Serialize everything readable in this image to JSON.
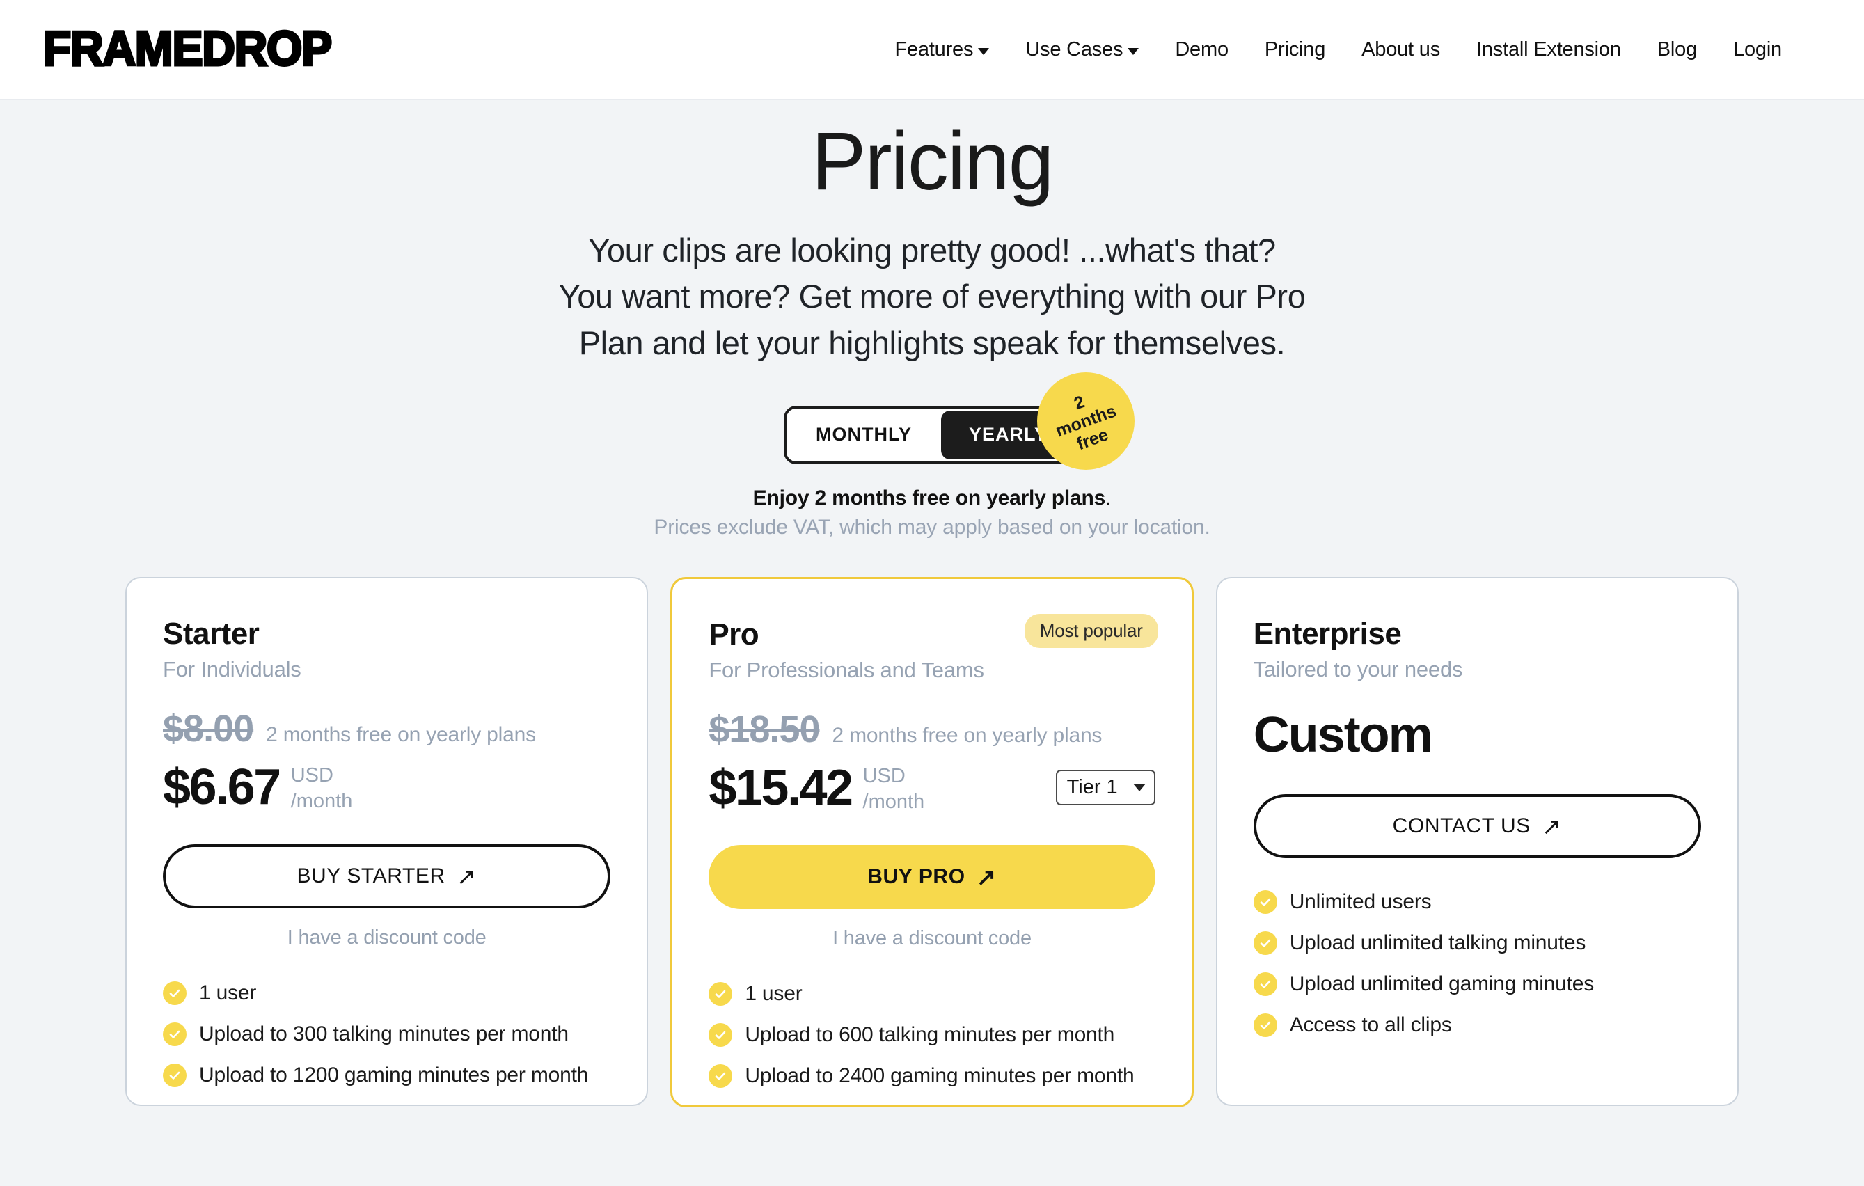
{
  "header": {
    "logo": "FRAMEDROP",
    "nav": [
      {
        "label": "Features",
        "has_caret": true
      },
      {
        "label": "Use Cases",
        "has_caret": true
      },
      {
        "label": "Demo",
        "has_caret": false
      },
      {
        "label": "Pricing",
        "has_caret": false
      },
      {
        "label": "About us",
        "has_caret": false
      },
      {
        "label": "Install Extension",
        "has_caret": false
      },
      {
        "label": "Blog",
        "has_caret": false
      },
      {
        "label": "Login",
        "has_caret": false
      }
    ]
  },
  "hero": {
    "title": "Pricing",
    "subtitle_line1": "Your clips are looking pretty good! ...what's that?",
    "subtitle_line2": "You want more? Get more of everything with our Pro",
    "subtitle_line3": "Plan and let your highlights speak for themselves."
  },
  "billing_toggle": {
    "monthly_label": "MONTHLY",
    "yearly_label": "YEARLY",
    "selected": "YEARLY",
    "badge_line1": "2",
    "badge_line2": "months",
    "badge_line3": "free",
    "note_bold": "Enjoy 2 months free on yearly plans",
    "note_bold_period": ".",
    "note_muted": "Prices exclude VAT, which may apply based on your location."
  },
  "colors": {
    "accent_yellow": "#F7D94C",
    "badge_yellow": "#F8E59B",
    "page_background": "#F2F4F6",
    "muted_text": "#96A2B2",
    "featured_border": "#F0C93B"
  },
  "plans": [
    {
      "name": "Starter",
      "audience": "For Individuals",
      "old_price": "$8.00",
      "free_note": "2 months free on yearly plans",
      "price": "$6.67",
      "currency": "USD",
      "period": "/month",
      "cta_label": "BUY STARTER",
      "discount_link": "I have a discount code",
      "features": [
        "1 user",
        "Upload to 300 talking minutes per month",
        "Upload to 1200 gaming minutes per month"
      ]
    },
    {
      "name": "Pro",
      "audience": "For Professionals and Teams",
      "popular_badge": "Most popular",
      "old_price": "$18.50",
      "free_note": "2 months free on yearly plans",
      "price": "$15.42",
      "currency": "USD",
      "period": "/month",
      "tier_selected": "Tier 1",
      "cta_label": "BUY PRO",
      "discount_link": "I have a discount code",
      "features": [
        "1 user",
        "Upload to 600 talking minutes per month",
        "Upload to 2400 gaming minutes per month"
      ]
    },
    {
      "name": "Enterprise",
      "audience": "Tailored to your needs",
      "price": "Custom",
      "cta_label": "CONTACT US",
      "features": [
        "Unlimited users",
        "Upload unlimited talking minutes",
        "Upload unlimited gaming minutes",
        "Access to all clips"
      ]
    }
  ]
}
